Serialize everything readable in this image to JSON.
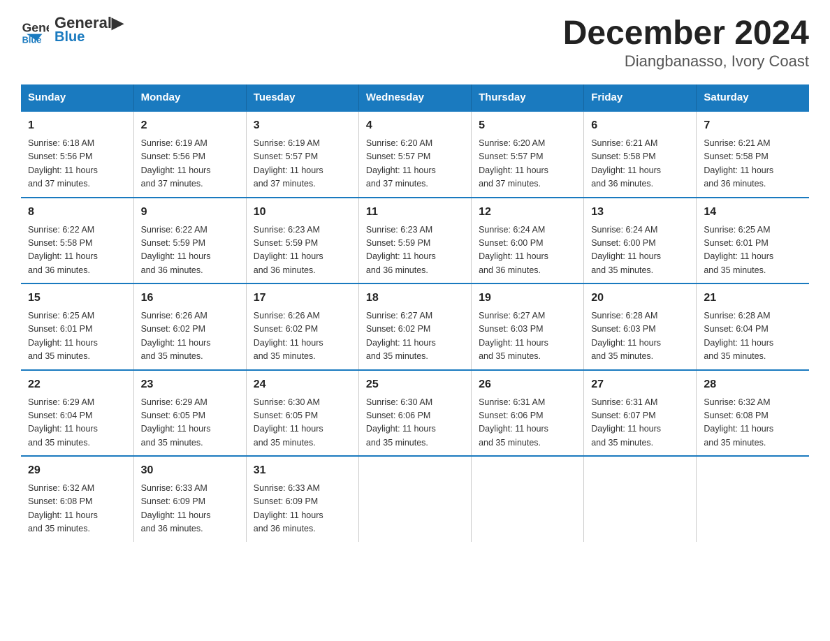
{
  "header": {
    "logo_line1": "General",
    "logo_line2": "Blue",
    "title": "December 2024",
    "subtitle": "Diangbanasso, Ivory Coast"
  },
  "days_of_week": [
    "Sunday",
    "Monday",
    "Tuesday",
    "Wednesday",
    "Thursday",
    "Friday",
    "Saturday"
  ],
  "weeks": [
    [
      {
        "day": "1",
        "info": "Sunrise: 6:18 AM\nSunset: 5:56 PM\nDaylight: 11 hours\nand 37 minutes."
      },
      {
        "day": "2",
        "info": "Sunrise: 6:19 AM\nSunset: 5:56 PM\nDaylight: 11 hours\nand 37 minutes."
      },
      {
        "day": "3",
        "info": "Sunrise: 6:19 AM\nSunset: 5:57 PM\nDaylight: 11 hours\nand 37 minutes."
      },
      {
        "day": "4",
        "info": "Sunrise: 6:20 AM\nSunset: 5:57 PM\nDaylight: 11 hours\nand 37 minutes."
      },
      {
        "day": "5",
        "info": "Sunrise: 6:20 AM\nSunset: 5:57 PM\nDaylight: 11 hours\nand 37 minutes."
      },
      {
        "day": "6",
        "info": "Sunrise: 6:21 AM\nSunset: 5:58 PM\nDaylight: 11 hours\nand 36 minutes."
      },
      {
        "day": "7",
        "info": "Sunrise: 6:21 AM\nSunset: 5:58 PM\nDaylight: 11 hours\nand 36 minutes."
      }
    ],
    [
      {
        "day": "8",
        "info": "Sunrise: 6:22 AM\nSunset: 5:58 PM\nDaylight: 11 hours\nand 36 minutes."
      },
      {
        "day": "9",
        "info": "Sunrise: 6:22 AM\nSunset: 5:59 PM\nDaylight: 11 hours\nand 36 minutes."
      },
      {
        "day": "10",
        "info": "Sunrise: 6:23 AM\nSunset: 5:59 PM\nDaylight: 11 hours\nand 36 minutes."
      },
      {
        "day": "11",
        "info": "Sunrise: 6:23 AM\nSunset: 5:59 PM\nDaylight: 11 hours\nand 36 minutes."
      },
      {
        "day": "12",
        "info": "Sunrise: 6:24 AM\nSunset: 6:00 PM\nDaylight: 11 hours\nand 36 minutes."
      },
      {
        "day": "13",
        "info": "Sunrise: 6:24 AM\nSunset: 6:00 PM\nDaylight: 11 hours\nand 35 minutes."
      },
      {
        "day": "14",
        "info": "Sunrise: 6:25 AM\nSunset: 6:01 PM\nDaylight: 11 hours\nand 35 minutes."
      }
    ],
    [
      {
        "day": "15",
        "info": "Sunrise: 6:25 AM\nSunset: 6:01 PM\nDaylight: 11 hours\nand 35 minutes."
      },
      {
        "day": "16",
        "info": "Sunrise: 6:26 AM\nSunset: 6:02 PM\nDaylight: 11 hours\nand 35 minutes."
      },
      {
        "day": "17",
        "info": "Sunrise: 6:26 AM\nSunset: 6:02 PM\nDaylight: 11 hours\nand 35 minutes."
      },
      {
        "day": "18",
        "info": "Sunrise: 6:27 AM\nSunset: 6:02 PM\nDaylight: 11 hours\nand 35 minutes."
      },
      {
        "day": "19",
        "info": "Sunrise: 6:27 AM\nSunset: 6:03 PM\nDaylight: 11 hours\nand 35 minutes."
      },
      {
        "day": "20",
        "info": "Sunrise: 6:28 AM\nSunset: 6:03 PM\nDaylight: 11 hours\nand 35 minutes."
      },
      {
        "day": "21",
        "info": "Sunrise: 6:28 AM\nSunset: 6:04 PM\nDaylight: 11 hours\nand 35 minutes."
      }
    ],
    [
      {
        "day": "22",
        "info": "Sunrise: 6:29 AM\nSunset: 6:04 PM\nDaylight: 11 hours\nand 35 minutes."
      },
      {
        "day": "23",
        "info": "Sunrise: 6:29 AM\nSunset: 6:05 PM\nDaylight: 11 hours\nand 35 minutes."
      },
      {
        "day": "24",
        "info": "Sunrise: 6:30 AM\nSunset: 6:05 PM\nDaylight: 11 hours\nand 35 minutes."
      },
      {
        "day": "25",
        "info": "Sunrise: 6:30 AM\nSunset: 6:06 PM\nDaylight: 11 hours\nand 35 minutes."
      },
      {
        "day": "26",
        "info": "Sunrise: 6:31 AM\nSunset: 6:06 PM\nDaylight: 11 hours\nand 35 minutes."
      },
      {
        "day": "27",
        "info": "Sunrise: 6:31 AM\nSunset: 6:07 PM\nDaylight: 11 hours\nand 35 minutes."
      },
      {
        "day": "28",
        "info": "Sunrise: 6:32 AM\nSunset: 6:08 PM\nDaylight: 11 hours\nand 35 minutes."
      }
    ],
    [
      {
        "day": "29",
        "info": "Sunrise: 6:32 AM\nSunset: 6:08 PM\nDaylight: 11 hours\nand 35 minutes."
      },
      {
        "day": "30",
        "info": "Sunrise: 6:33 AM\nSunset: 6:09 PM\nDaylight: 11 hours\nand 36 minutes."
      },
      {
        "day": "31",
        "info": "Sunrise: 6:33 AM\nSunset: 6:09 PM\nDaylight: 11 hours\nand 36 minutes."
      },
      {
        "day": "",
        "info": ""
      },
      {
        "day": "",
        "info": ""
      },
      {
        "day": "",
        "info": ""
      },
      {
        "day": "",
        "info": ""
      }
    ]
  ]
}
